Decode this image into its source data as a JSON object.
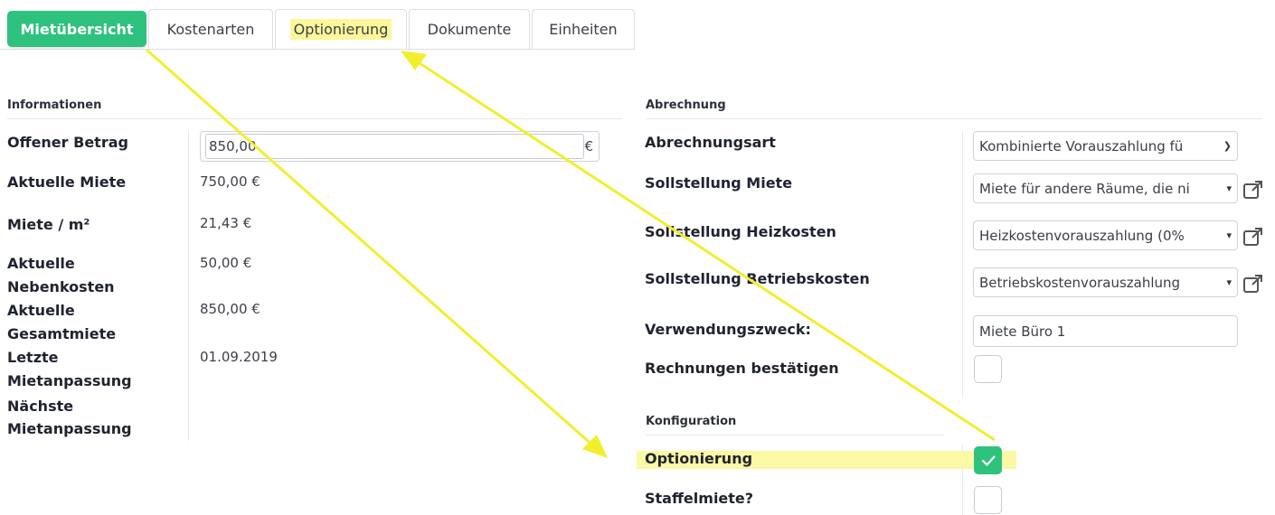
{
  "tabs": [
    {
      "label": "Mietübersicht"
    },
    {
      "label": "Kostenarten"
    },
    {
      "label": "Optionierung"
    },
    {
      "label": "Dokumente"
    },
    {
      "label": "Einheiten"
    }
  ],
  "info": {
    "title": "Informationen",
    "offener_betrag": {
      "label": "Offener Betrag",
      "value": "850,00",
      "unit": "€"
    },
    "aktuelle_miete": {
      "label": "Aktuelle Miete",
      "value": "750,00 €"
    },
    "miete_m2": {
      "label": "Miete / m²",
      "value": "21,43 €"
    },
    "nebenkosten": {
      "label1": "Aktuelle",
      "label2": "Nebenkosten",
      "value": "50,00 €"
    },
    "gesamtmiete": {
      "label1": "Aktuelle",
      "label2": "Gesamtmiete",
      "value": "850,00 €"
    },
    "letzte": {
      "label1": "Letzte",
      "label2": "Mietanpassung",
      "value": "01.09.2019"
    },
    "naechste": {
      "label1": "Nächste",
      "label2": "Mietanpassung"
    }
  },
  "abrechnung": {
    "title": "Abrechnung",
    "art": {
      "label": "Abrechnungsart",
      "value": "Kombinierte Vorauszahlung fü"
    },
    "miete": {
      "label": "Sollstellung Miete",
      "value": "Miete für andere Räume, die ni"
    },
    "heizkosten": {
      "label": "Sollstellung Heizkosten",
      "value": "Heizkostenvorauszahlung (0%"
    },
    "betriebskosten": {
      "label": "Sollstellung Betriebskosten",
      "value": "Betriebskostenvorauszahlung"
    },
    "zweck": {
      "label": "Verwendungszweck:",
      "value": "Miete Büro 1"
    },
    "rechnungen": {
      "label": "Rechnungen bestätigen",
      "checked": false
    }
  },
  "konfiguration": {
    "title": "Konfiguration",
    "optionierung": {
      "label": "Optionierung",
      "checked": true
    },
    "staffelmiete": {
      "label": "Staffelmiete?",
      "checked": false
    }
  },
  "colors": {
    "accent": "#2ec27e",
    "highlight": "#fbf79a",
    "arrow": "#f2ee2e"
  }
}
